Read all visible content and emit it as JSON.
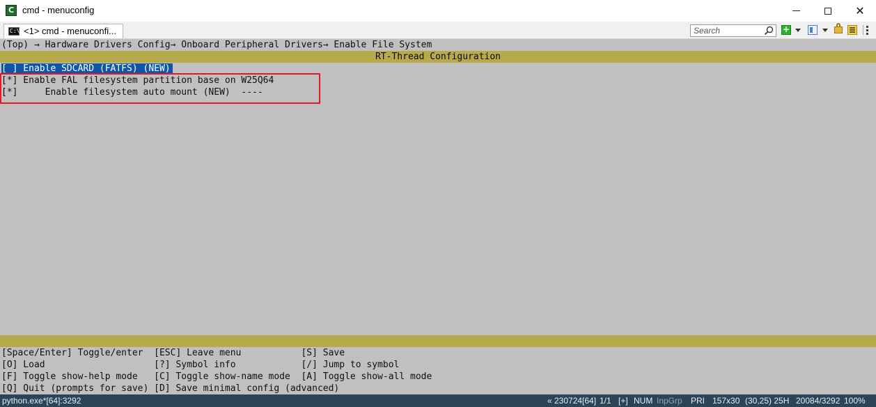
{
  "window": {
    "title": "cmd - menuconfig",
    "app_icon_glyph": "C"
  },
  "tab": {
    "label": "<1> cmd - menuconfi..."
  },
  "toolbar": {
    "search_placeholder": "Search",
    "add_glyph": "+"
  },
  "menuconfig": {
    "breadcrumb": "(Top) → Hardware Drivers Config→ Onboard Peripheral Drivers→ Enable File System",
    "header_title": "RT-Thread Configuration",
    "items": [
      {
        "text": "[ ] Enable SDCARD (FATFS) (NEW)",
        "selected": true
      },
      {
        "text": "[*] Enable FAL filesystem partition base on W25Q64",
        "selected": false
      },
      {
        "text": "[*]     Enable filesystem auto mount (NEW)  ----",
        "selected": false
      }
    ],
    "help_lines": [
      "[Space/Enter] Toggle/enter  [ESC] Leave menu           [S] Save",
      "[O] Load                    [?] Symbol info            [/] Jump to symbol",
      "[F] Toggle show-help mode   [C] Toggle show-name mode  [A] Toggle show-all mode",
      "[Q] Quit (prompts for save) [D] Save minimal config (advanced)"
    ]
  },
  "statusbar": {
    "process": "python.exe*[64]:3292",
    "build": "« 230724[64]",
    "page": "1/1",
    "flags_plus": "[+]",
    "num": "NUM",
    "inpgrp": "InpGrp",
    "priority": "PRI",
    "size": "157x30",
    "cursor": "(30,25) 25H",
    "pid": "20084/3292",
    "zoom": "100%"
  },
  "colors": {
    "terminal_bg": "#c0c0c0",
    "bar": "#b7aa4a",
    "selection": "#0f56a8",
    "highlight_box": "#e01b24",
    "statusbar_bg": "#2b4557"
  }
}
